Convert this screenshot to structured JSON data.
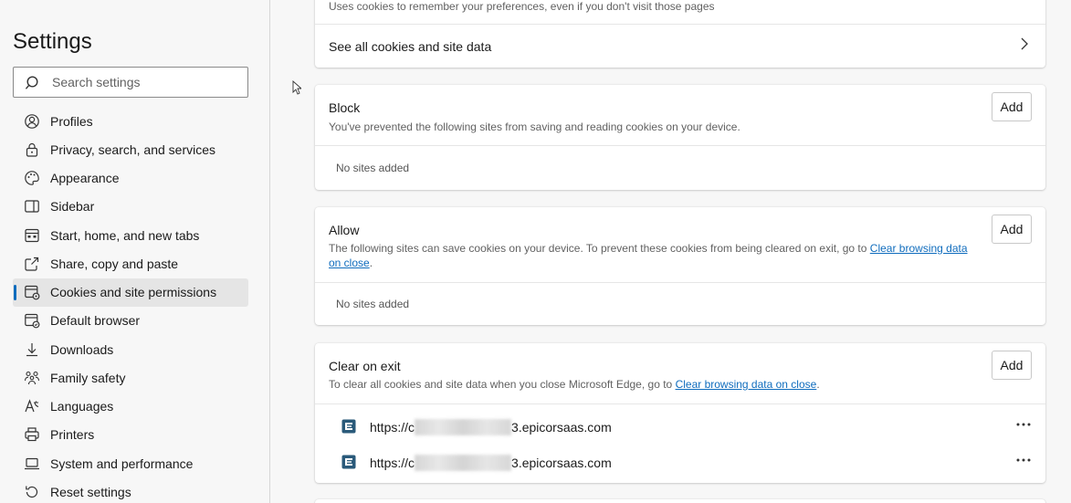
{
  "sidebar": {
    "title": "Settings",
    "search_placeholder": "Search settings",
    "items": [
      {
        "label": "Profiles",
        "icon": "profile-icon"
      },
      {
        "label": "Privacy, search, and services",
        "icon": "lock-icon"
      },
      {
        "label": "Appearance",
        "icon": "palette-icon"
      },
      {
        "label": "Sidebar",
        "icon": "sidebar-icon"
      },
      {
        "label": "Start, home, and new tabs",
        "icon": "home-tabs-icon"
      },
      {
        "label": "Share, copy and paste",
        "icon": "share-icon"
      },
      {
        "label": "Cookies and site permissions",
        "icon": "cookies-permissions-icon",
        "active": true
      },
      {
        "label": "Default browser",
        "icon": "default-browser-icon"
      },
      {
        "label": "Downloads",
        "icon": "download-icon"
      },
      {
        "label": "Family safety",
        "icon": "family-icon"
      },
      {
        "label": "Languages",
        "icon": "languages-icon"
      },
      {
        "label": "Printers",
        "icon": "printer-icon"
      },
      {
        "label": "System and performance",
        "icon": "laptop-icon"
      },
      {
        "label": "Reset settings",
        "icon": "reset-icon"
      }
    ]
  },
  "main": {
    "top_card": {
      "description": "Uses cookies to remember your preferences, even if you don't visit those pages",
      "see_all_label": "See all cookies and site data"
    },
    "block": {
      "title": "Block",
      "description": "You've prevented the following sites from saving and reading cookies on your device.",
      "add_label": "Add",
      "empty_text": "No sites added"
    },
    "allow": {
      "title": "Allow",
      "description": "The following sites can save cookies on your device. To prevent these cookies from being cleared on exit, go to",
      "link_text": "Clear browsing data on close",
      "suffix": ".",
      "add_label": "Add",
      "empty_text": "No sites added"
    },
    "clear_on_exit": {
      "title": "Clear on exit",
      "description": "To clear all cookies and site data when you close Microsoft Edge, go to",
      "link_text": "Clear browsing data on close",
      "suffix": ".",
      "add_label": "Add",
      "sites": [
        {
          "prefix": "https://",
          "tail_char": "c",
          "suffix": ".epicorsaas.com",
          "mid_char": "3"
        },
        {
          "prefix": "https://",
          "tail_char": "c",
          "suffix": ".epicorsaas.com",
          "mid_char": "3"
        }
      ]
    }
  },
  "colors": {
    "accent": "#0f6cbd",
    "active_bg": "#e5e5e5",
    "favicon": "#2a5a7a"
  }
}
